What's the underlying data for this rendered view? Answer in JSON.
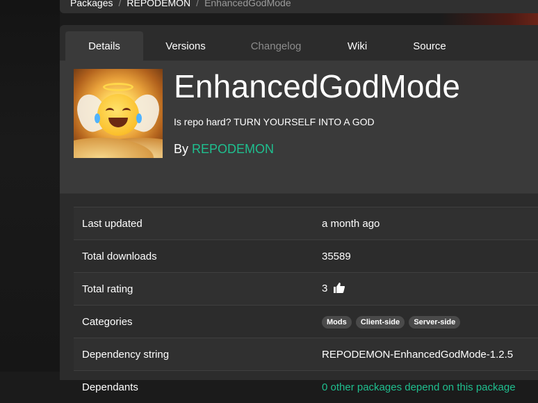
{
  "breadcrumb": {
    "items": [
      "Packages",
      "REPODEMON"
    ],
    "current": "EnhancedGodMode",
    "separator": "/"
  },
  "tabs": [
    {
      "label": "Details",
      "state": "active"
    },
    {
      "label": "Versions",
      "state": "normal"
    },
    {
      "label": "Changelog",
      "state": "disabled"
    },
    {
      "label": "Wiki",
      "state": "normal"
    },
    {
      "label": "Source",
      "state": "normal"
    }
  ],
  "package": {
    "name": "EnhancedGodMode",
    "description": "Is repo hard? TURN YOURSELF INTO A GOD",
    "by_label": "By",
    "author": "REPODEMON",
    "icon": "laughing-angel-emoji-icon"
  },
  "details": {
    "last_updated": {
      "label": "Last updated",
      "value": "a month ago"
    },
    "total_downloads": {
      "label": "Total downloads",
      "value": "35589"
    },
    "total_rating": {
      "label": "Total rating",
      "value": "3"
    },
    "categories": {
      "label": "Categories",
      "values": [
        "Mods",
        "Client-side",
        "Server-side"
      ]
    },
    "dependency_string": {
      "label": "Dependency string",
      "value": "REPODEMON-EnhancedGodMode-1.2.5"
    },
    "dependants": {
      "label": "Dependants",
      "value": "0 other packages depend on this package"
    }
  },
  "colors": {
    "accent": "#1fbf8f",
    "panel": "#2c2c2c",
    "header": "#3a3a3a"
  }
}
